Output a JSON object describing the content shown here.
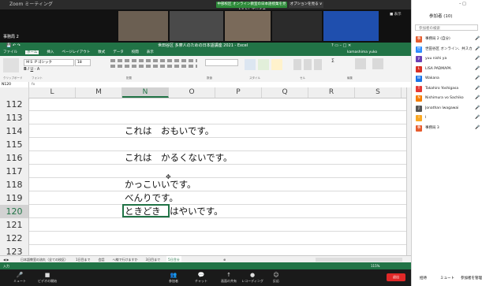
{
  "zoom": {
    "window_title": "Zoom ミーティング",
    "share_banner": "中部校区 オンライン教室の日本語授業を見ようとしています",
    "share_options": "オプションを見る ∨",
    "view_label": "■ 表示",
    "tiles": [
      {
        "name": "事務局 2",
        "color": "#121212"
      },
      {
        "name": "",
        "color": "#6b5f52"
      },
      {
        "name": "",
        "color": "#4a4a4a"
      },
      {
        "name": "",
        "color": "#7a6a5a"
      },
      {
        "name": "",
        "color": "#2b2b2b"
      },
      {
        "name": "",
        "color": "#1f4fae"
      }
    ],
    "controls": [
      {
        "icon": "mic-icon",
        "glyph": "🎤",
        "label": "ミュート"
      },
      {
        "icon": "video-icon",
        "glyph": "■",
        "label": "ビデオの開始"
      },
      {
        "icon": "participants-icon",
        "glyph": "👥",
        "label": "参加者"
      },
      {
        "icon": "chat-icon",
        "glyph": "💬",
        "label": "チャット"
      },
      {
        "icon": "share-icon",
        "glyph": "↑",
        "label": "画面の共有"
      },
      {
        "icon": "record-icon",
        "glyph": "●",
        "label": "レコーディング"
      },
      {
        "icon": "reactions-icon",
        "glyph": "☺",
        "label": "反応"
      },
      {
        "icon": "leave-icon",
        "glyph": "",
        "label": "退出"
      }
    ]
  },
  "sidebar": {
    "window_buttons": "–  □",
    "title": "参加者 (10)",
    "search_placeholder": "参加者の検索",
    "participants": [
      {
        "name": "事務局 2 (自分)",
        "initial": "事",
        "color": "#e65c2e"
      },
      {
        "name": "世田谷区 オンライン、共スカ",
        "initial": "世",
        "color": "#2d8cff"
      },
      {
        "name": "yuu nishi ya",
        "initial": "y",
        "color": "#6a3fb5"
      },
      {
        "name": "LISA PADMAPA",
        "initial": "L",
        "color": "#d93025"
      },
      {
        "name": "Wakana",
        "initial": "W",
        "color": "#1a73e8"
      },
      {
        "name": "Takahiro Yoshigasa",
        "initial": "T",
        "color": "#e53935"
      },
      {
        "name": "Nishimura vo Sachiko",
        "initial": "N",
        "color": "#f57c00"
      },
      {
        "name": "Jonathan Iwagawai",
        "initial": "J",
        "color": "#555555"
      },
      {
        "name": "I",
        "initial": "I",
        "color": "#f9a825"
      },
      {
        "name": "事務局 3",
        "initial": "事",
        "color": "#e65c2e"
      }
    ],
    "footer": [
      "招待",
      "ミュート",
      "参加者を管理"
    ]
  },
  "excel": {
    "title": "世田谷区 多摩人のための日本語講座 2021 - Excel",
    "user": "kamashima yuko",
    "tabs": [
      "ファイル",
      "ホーム",
      "挿入",
      "ページレイアウト",
      "数式",
      "データ",
      "校閲",
      "表示"
    ],
    "font_name": "ＭＳ Ｐゴシック",
    "font_size": "18",
    "ribbon_groups": [
      "クリップボード",
      "フォント",
      "配置",
      "数値",
      "スタイル",
      "セル",
      "編集"
    ],
    "name_box": "N120",
    "columns": [
      "L",
      "M",
      "N",
      "O",
      "P",
      "Q",
      "R",
      "S"
    ],
    "selected_column": "N",
    "rows": [
      {
        "num": "112",
        "text": ""
      },
      {
        "num": "113",
        "text": ""
      },
      {
        "num": "114",
        "text": "これは　おもいです。"
      },
      {
        "num": "115",
        "text": ""
      },
      {
        "num": "116",
        "text": "これは　かるくないです。"
      },
      {
        "num": "117",
        "text": ""
      },
      {
        "num": "118",
        "text": "かっこいいです。"
      },
      {
        "num": "119",
        "text": "べんりです。"
      },
      {
        "num": "120",
        "text": "ときどき　はやいです。"
      },
      {
        "num": "121",
        "text": ""
      },
      {
        "num": "122",
        "text": ""
      },
      {
        "num": "123",
        "text": ""
      }
    ],
    "selected_row": "120",
    "sheet_tabs": [
      "日本語教室の流れ（全ての校区）",
      "1日目まで",
      "会話",
      "へ線で行けますか",
      "3日目まで",
      "5日目分"
    ],
    "active_sheet": "5日目分",
    "status_left": "入力",
    "zoom_level": "115%"
  }
}
